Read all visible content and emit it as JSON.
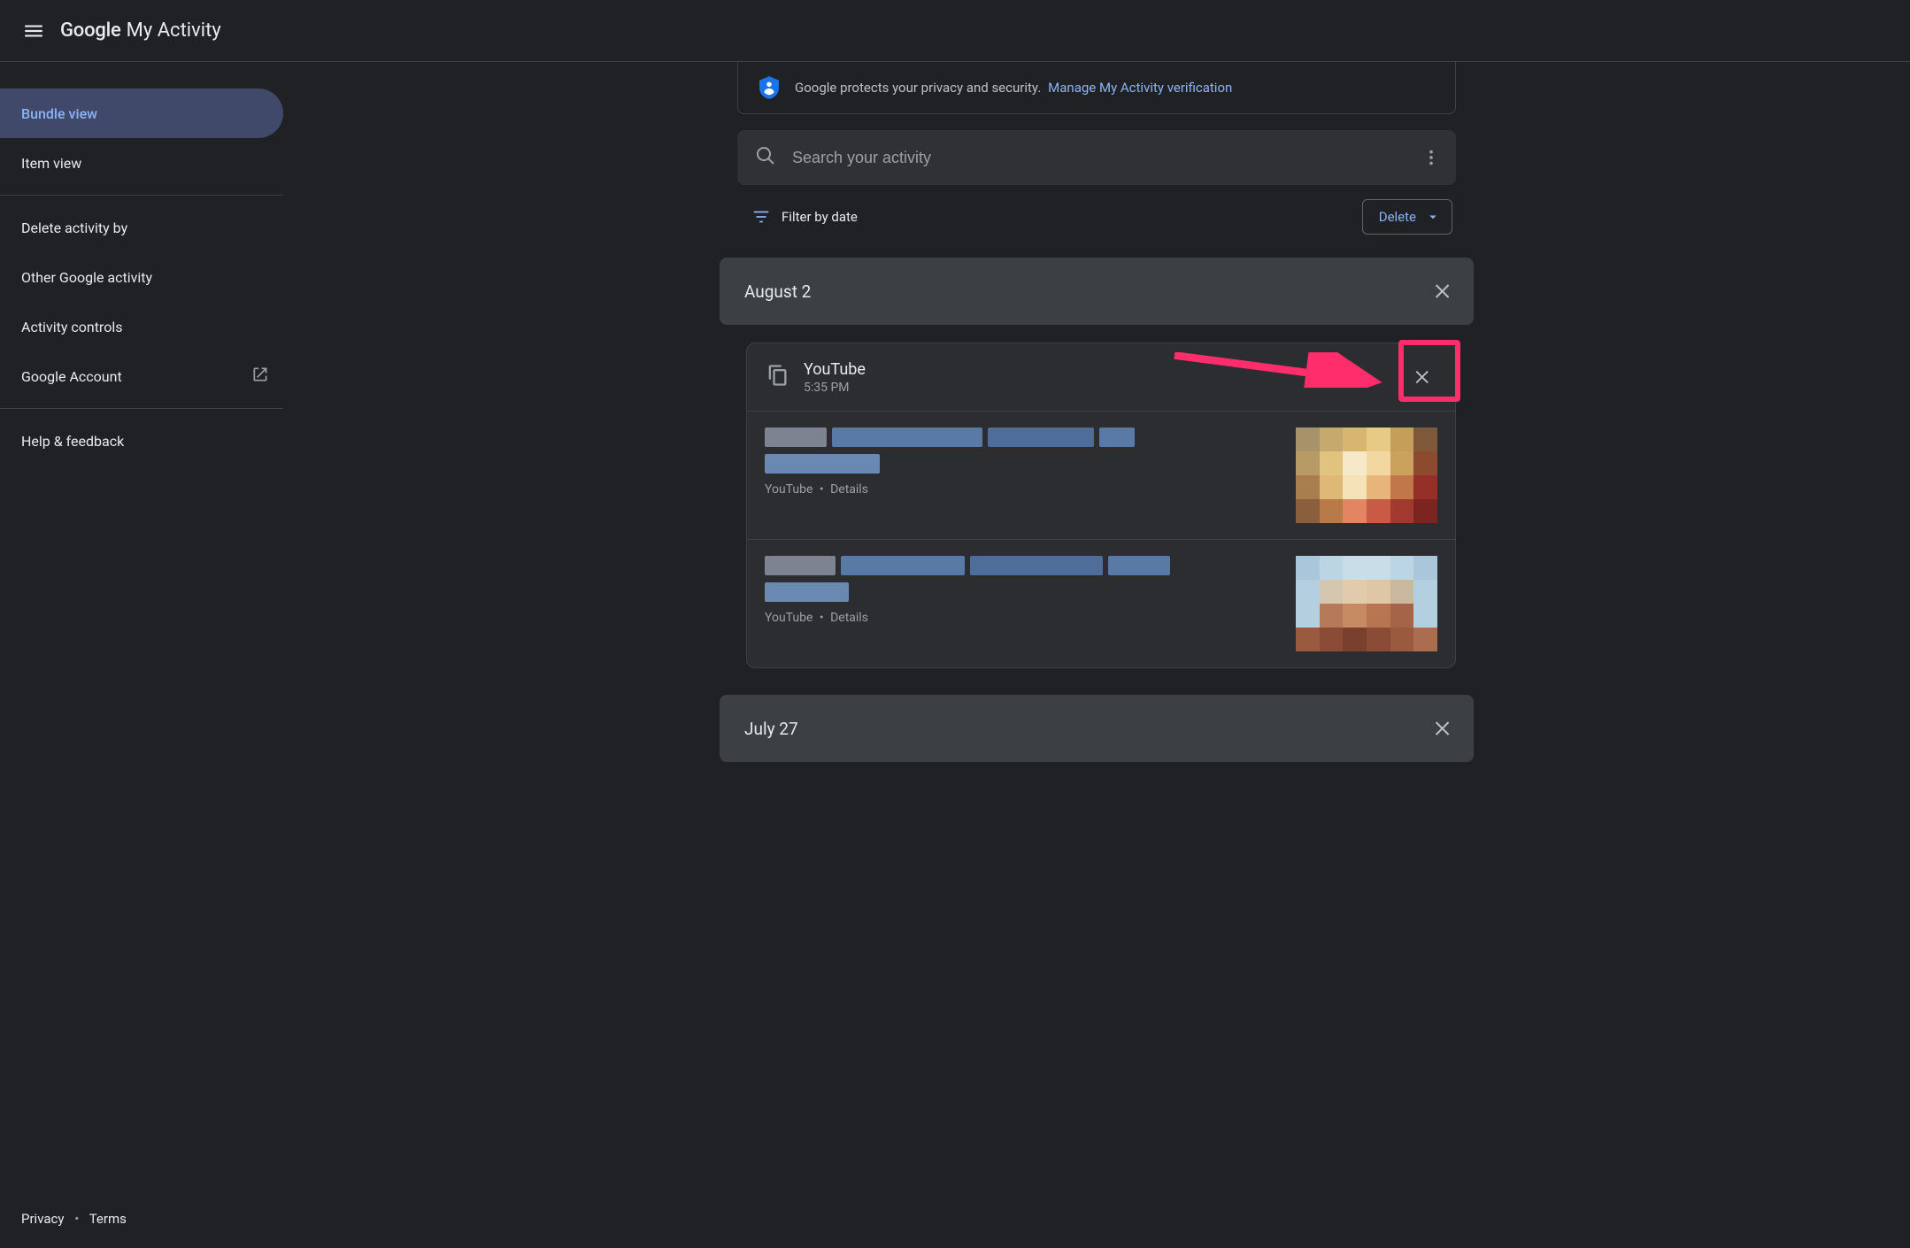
{
  "header": {
    "logo_brand": "Google",
    "logo_product": "My Activity"
  },
  "sidebar": {
    "items": [
      {
        "label": "Bundle view",
        "active": true
      },
      {
        "label": "Item view"
      }
    ],
    "items2": [
      {
        "label": "Delete activity by"
      },
      {
        "label": "Other Google activity"
      },
      {
        "label": "Activity controls"
      },
      {
        "label": "Google Account",
        "external": true
      }
    ],
    "items3": [
      {
        "label": "Help & feedback"
      }
    ],
    "footer": {
      "privacy": "Privacy",
      "terms": "Terms"
    }
  },
  "banner": {
    "text": "Google protects your privacy and security.",
    "link": "Manage My Activity verification"
  },
  "search": {
    "placeholder": "Search your activity"
  },
  "filter": {
    "label": "Filter by date",
    "delete_label": "Delete"
  },
  "groups": [
    {
      "date": "August 2"
    }
  ],
  "card": {
    "service": "YouTube",
    "time": "5:35 PM",
    "items": [
      {
        "source": "YouTube",
        "details": "Details"
      },
      {
        "source": "YouTube",
        "details": "Details"
      }
    ]
  },
  "group2": {
    "date": "July 27"
  }
}
